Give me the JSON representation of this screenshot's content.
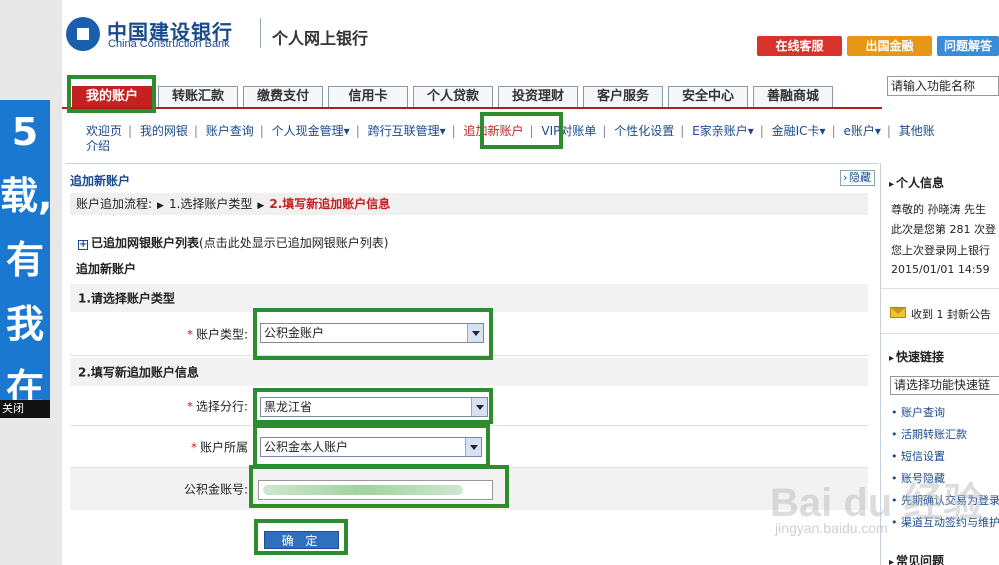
{
  "left_ad": {
    "text": [
      "5",
      "载,",
      "有",
      "我",
      "在"
    ],
    "close": "关闭"
  },
  "header": {
    "logo_cn": "中国建设银行",
    "logo_en": "China Construction Bank",
    "site_title": "个人网上银行",
    "btn_online": "在线客服",
    "btn_finance": "出国金融",
    "btn_help": "问题解答"
  },
  "nav": {
    "tabs": [
      "我的账户",
      "转账汇款",
      "缴费支付",
      "信用卡",
      "个人贷款",
      "投资理财",
      "客户服务",
      "安全中心",
      "善融商城"
    ],
    "search_placeholder": "请输入功能名称"
  },
  "submenu": {
    "items": [
      "欢迎页",
      "我的网银",
      "账户查询",
      "个人现金管理▾",
      "跨行互联管理▾",
      "追加新账户",
      "VIP对账单",
      "个性化设置",
      "E家亲账户▾",
      "金融IC卡▾",
      "e账户▾",
      "其他账"
    ],
    "second_line": "介绍"
  },
  "main": {
    "title": "追加新账户",
    "hide": "隐藏",
    "flow_label": "账户追加流程:",
    "flow_step1": "1.选择账户类型",
    "flow_step2": "2.填写新追加账户信息",
    "added_list": "已追加网银账户列表",
    "added_list_note": "(点击此处显示已追加网银账户列表)",
    "section_title": "追加新账户",
    "step1": "1.请选择账户类型",
    "account_type_label": "账户类型:",
    "account_type_value": "公积金账户",
    "step2": "2.填写新追加账户信息",
    "branch_label": "选择分行:",
    "branch_value": "黑龙江省",
    "belong_label": "账户所属",
    "belong_value": "公积金本人账户",
    "acct_no_label": "公积金账号:",
    "confirm": "确 定"
  },
  "sidebar": {
    "personal_info": "个人信息",
    "greeting": "尊敬的 孙晓涛 先生",
    "visit_count": "此次是您第 281 次登",
    "last_login": "您上次登录网上银行",
    "last_time": "2015/01/01 14:59",
    "mail": "收到 1 封新公告",
    "quick_links": "快速链接",
    "quick_select": "请选择功能快速链",
    "links": [
      "账户查询",
      "活期转账汇款",
      "短信设置",
      "账号隐藏",
      "先期确认交易为登录",
      "渠道互动签约与维护"
    ],
    "faq": "常见问题"
  },
  "watermark": {
    "main": "Bai du 经验",
    "sub": "jingyan.baidu.com"
  },
  "colors": {
    "brand_blue": "#1a4a8c",
    "active_red": "#c42222",
    "highlight_green": "#2e8b2e"
  }
}
